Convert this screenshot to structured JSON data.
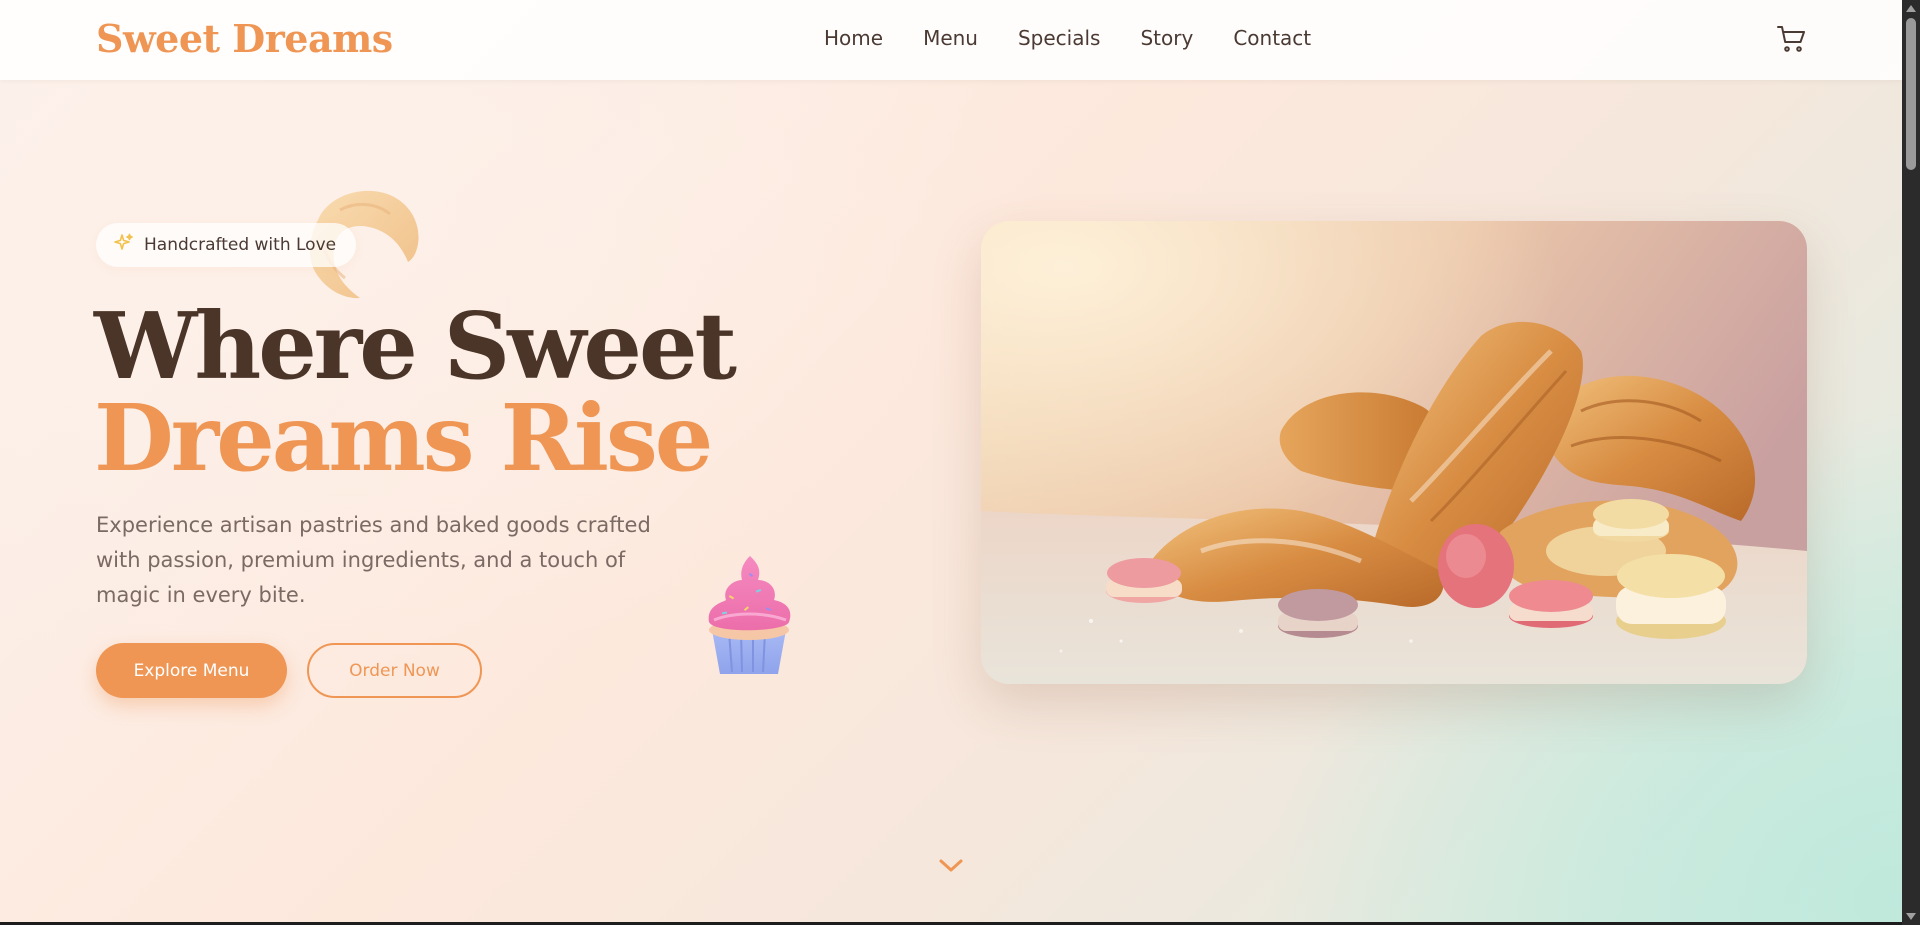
{
  "brand": {
    "name": "Sweet Dreams",
    "accent": "#ef9655",
    "dark": "#4b3529"
  },
  "nav": {
    "items": [
      {
        "label": "Home"
      },
      {
        "label": "Menu"
      },
      {
        "label": "Specials"
      },
      {
        "label": "Story"
      },
      {
        "label": "Contact"
      }
    ],
    "cart_icon": "cart-icon"
  },
  "hero": {
    "badge": {
      "icon": "sparkle-icon",
      "label": "Handcrafted with Love"
    },
    "title_line1": "Where Sweet",
    "title_line2": "Dreams Rise",
    "description": "Experience artisan pastries and baked goods crafted with passion, premium ingredients, and a touch of magic in every bite.",
    "primary_button": "Explore Menu",
    "secondary_button": "Order Now",
    "decorations": [
      "croissant-icon",
      "cupcake-icon"
    ],
    "image": "photo of croissants and macarons",
    "scroll_icon": "chevron-down-icon"
  }
}
